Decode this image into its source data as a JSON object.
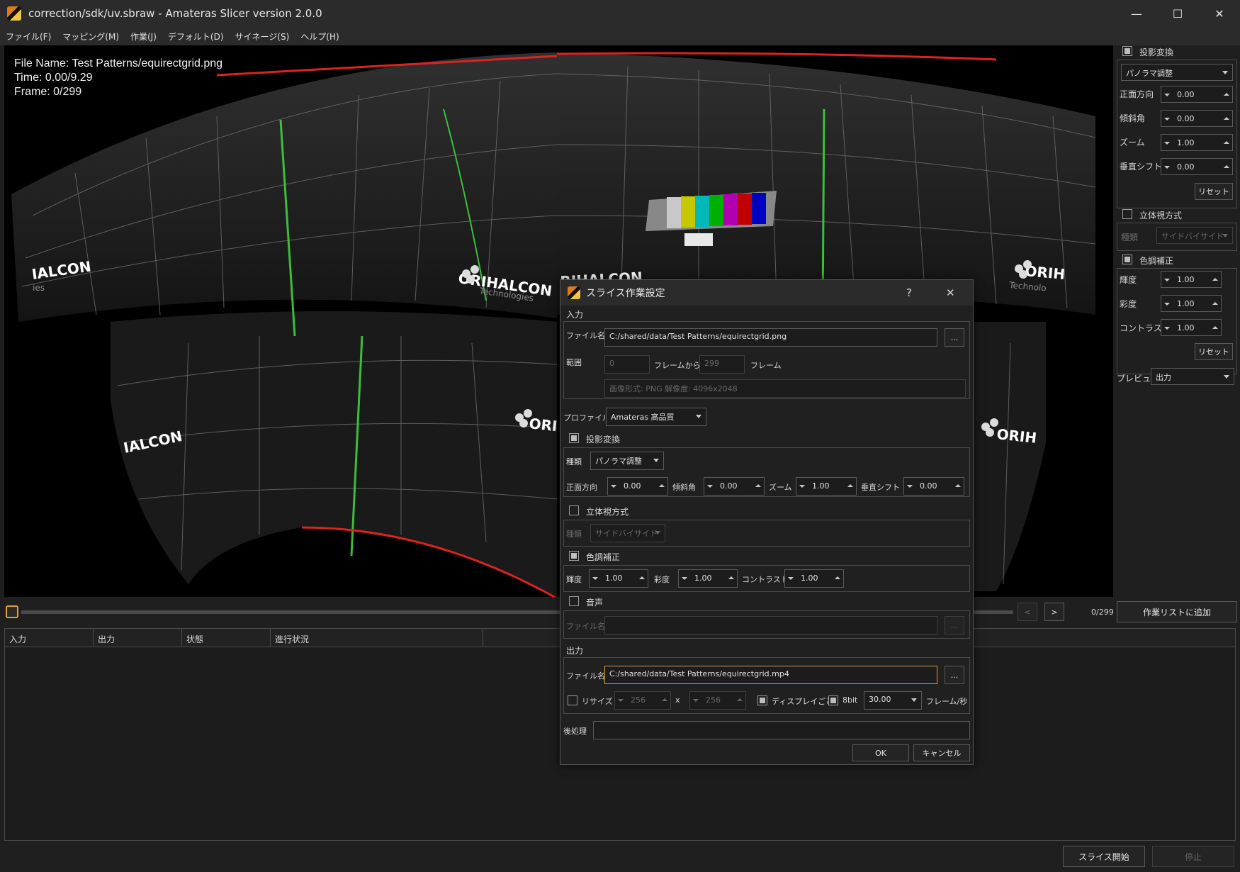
{
  "window": {
    "title": "correction/sdk/uv.sbraw - Amateras Slicer version 2.0.0",
    "min": "—",
    "max": "☐",
    "close": "✕"
  },
  "menu": [
    "ファイル(F)",
    "マッピング(M)",
    "作業(J)",
    "デフォルト(D)",
    "サイネージ(S)",
    "ヘルプ(H)"
  ],
  "overlay": {
    "file": "File Name: Test Patterns/equirectgrid.png",
    "time": "Time: 0.00/9.29",
    "frame": "Frame: 0/299"
  },
  "rpanel": {
    "projection_label": "投影変換",
    "projection_type": "パノラマ調整",
    "front_label": "正面方向",
    "front": "0.00",
    "tilt_label": "傾斜角",
    "tilt": "0.00",
    "zoom_label": "ズーム",
    "zoom": "1.00",
    "vshift_label": "垂直シフト",
    "vshift": "0.00",
    "reset": "リセット",
    "stereo_label": "立体視方式",
    "stereo_type_label": "種類",
    "stereo_type": "サイドバイサイド",
    "color_label": "色調補正",
    "brightness_label": "輝度",
    "brightness": "1.00",
    "saturation_label": "彩度",
    "saturation": "1.00",
    "contrast_label": "コントラスト",
    "contrast": "1.00",
    "reset2": "リセット",
    "preview_label": "プレビュー",
    "preview": "出力"
  },
  "timeline": {
    "counter": "0/299",
    "prev": "<",
    "next": ">",
    "add_job": "作業リストに追加"
  },
  "jobtable": {
    "columns": [
      "入力",
      "出力",
      "状態",
      "進行状況"
    ]
  },
  "footer": {
    "start": "スライス開始",
    "stop": "停止"
  },
  "dialog": {
    "title": "スライス作業設定",
    "help": "?",
    "close": "✕",
    "input_section": "入力",
    "file_label": "ファイル名",
    "file_value": "C:/shared/data/Test Patterns/equirectgrid.png",
    "browse": "...",
    "range_label": "範囲",
    "range_from": "0",
    "from_label": "フレームから",
    "range_to": "299",
    "frame_label": "フレーム",
    "format_info": "画像形式: PNG 解像度: 4096x2048",
    "profile_label": "プロファイル",
    "profile": "Amateras 高品質",
    "projection_label": "投影変換",
    "type_label": "種類",
    "type": "パノラマ調整",
    "front_label": "正面方向",
    "front": "0.00",
    "tilt_label": "傾斜角",
    "tilt": "0.00",
    "zoom_label": "ズーム",
    "zoom": "1.00",
    "vshift_label": "垂直シフト",
    "vshift": "0.00",
    "stereo_label": "立体視方式",
    "stereo_type_label": "種類",
    "stereo_type": "サイドバイサイド",
    "color_label": "色調補正",
    "brightness_label": "輝度",
    "brightness": "1.00",
    "saturation_label": "彩度",
    "saturation": "1.00",
    "contrast_label": "コントラスト",
    "contrast": "1.00",
    "audio_label": "音声",
    "audio_file_label": "ファイル名",
    "audio_file": "",
    "output_section": "出力",
    "out_file_label": "ファイル名",
    "out_file": "C:/shared/data/Test Patterns/equirectgrid.mp4",
    "resize_label": "リサイズ",
    "width": "256",
    "x": "x",
    "height": "256",
    "per_display_label": "ディスプレイごと",
    "bit8_label": "8bit",
    "fps": "30.00",
    "fps_label": "フレーム/秒",
    "post_label": "後処理",
    "post_value": "",
    "ok": "OK",
    "cancel": "キャンセル"
  },
  "graphics": {
    "logo_left_top": "IALCON",
    "logo_center": "ORIHALCON",
    "logo_right_top": "RIHALCON",
    "logo_far_right": "ORIH",
    "logo_left_bottom": "IALCON",
    "logo_center_bottom": "ORI",
    "logo_right_bottom": "ORIH",
    "sub_left": "ies",
    "sub_center": "Technologies",
    "sub_right": "Technolo"
  }
}
